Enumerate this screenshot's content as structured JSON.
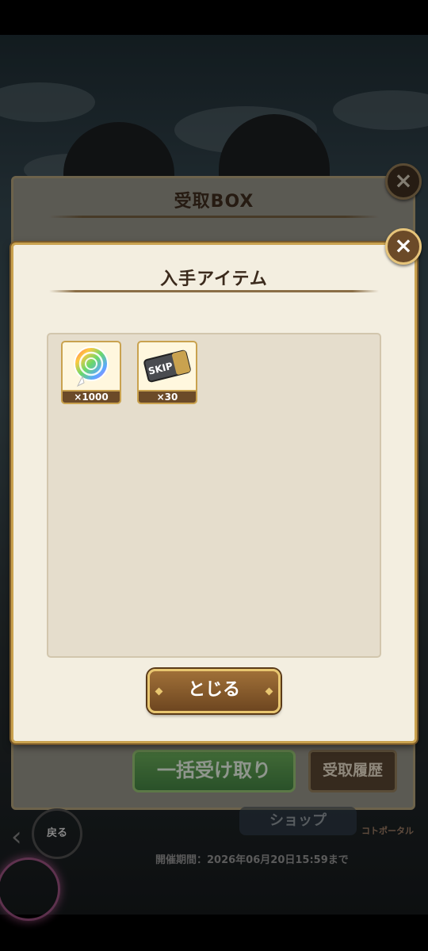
{
  "receive_box": {
    "title": "受取BOX",
    "close_label": "×",
    "bulk_receive_label": "一括受け取り",
    "history_label": "受取履歴"
  },
  "acquired_modal": {
    "title": "入手アイテム",
    "close_label": "×",
    "items": [
      {
        "name": "rainbow-medal",
        "count": "×1000"
      },
      {
        "name": "skip-ticket",
        "count": "×30",
        "icon_text": "SKIP"
      }
    ],
    "close_button_label": "とじる"
  },
  "background": {
    "back_label": "戻る",
    "shop_label": "ショップ",
    "portal_label": "コトポータル",
    "period_text": "開催期間：2026年06月20日15:59まで"
  },
  "colors": {
    "modal_bg": "#f3eee0",
    "gold_border": "#c9a24f",
    "brown_button": "#6e4620",
    "green_button": "#2e7a30"
  }
}
